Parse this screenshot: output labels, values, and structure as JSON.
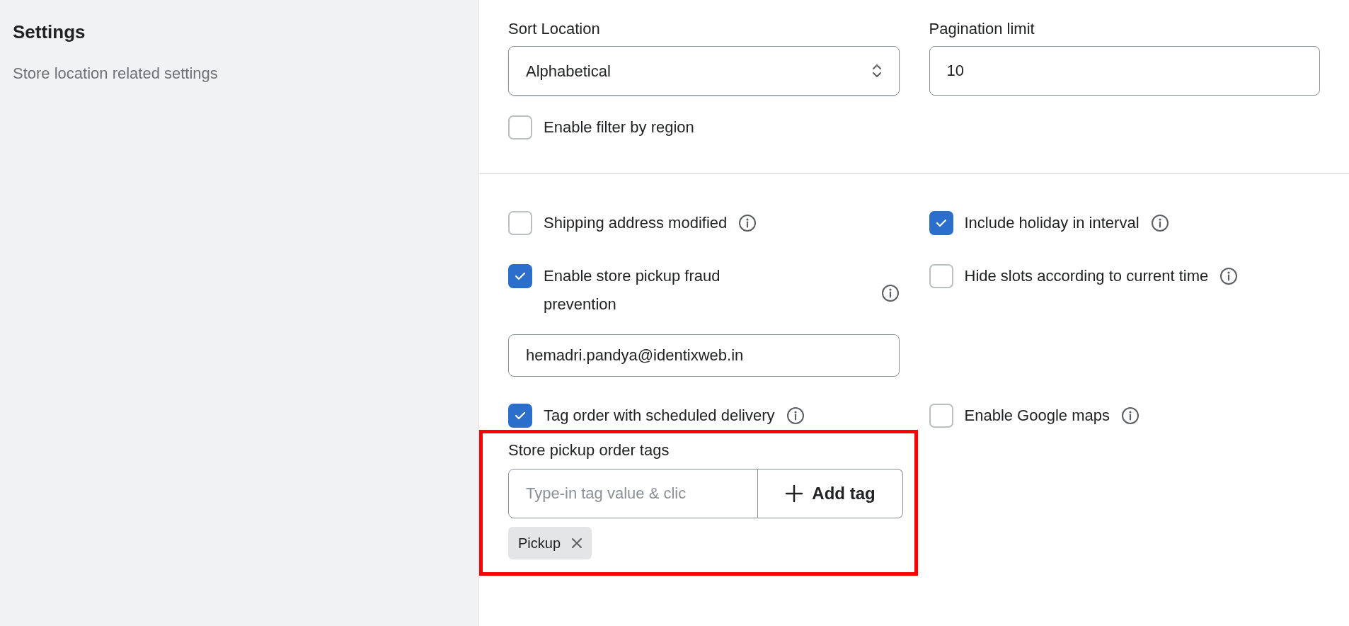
{
  "sidebar": {
    "title": "Settings",
    "description": "Store location related settings"
  },
  "sort_location": {
    "label": "Sort Location",
    "value": "Alphabetical"
  },
  "pagination_limit": {
    "label": "Pagination limit",
    "value": "10"
  },
  "filter_by_region": {
    "label": "Enable filter by region",
    "checked": false
  },
  "rows": [
    {
      "left": {
        "label": "Shipping address modified",
        "checked": false
      },
      "right": {
        "label": "Include holiday in interval",
        "checked": true
      }
    },
    {
      "left": {
        "label": "Enable store pickup fraud prevention",
        "checked": true,
        "email": "hemadri.pandya@identixweb.in"
      },
      "right": {
        "label": "Hide slots according to current time",
        "checked": false
      }
    },
    {
      "left": {
        "label": "Tag order with scheduled delivery",
        "checked": true,
        "tags": {
          "label": "Store pickup order tags",
          "placeholder": "Type-in tag value & clic",
          "button": "Add tag",
          "items": [
            "Pickup"
          ]
        }
      },
      "right": {
        "label": "Enable Google maps",
        "checked": false
      }
    }
  ]
}
